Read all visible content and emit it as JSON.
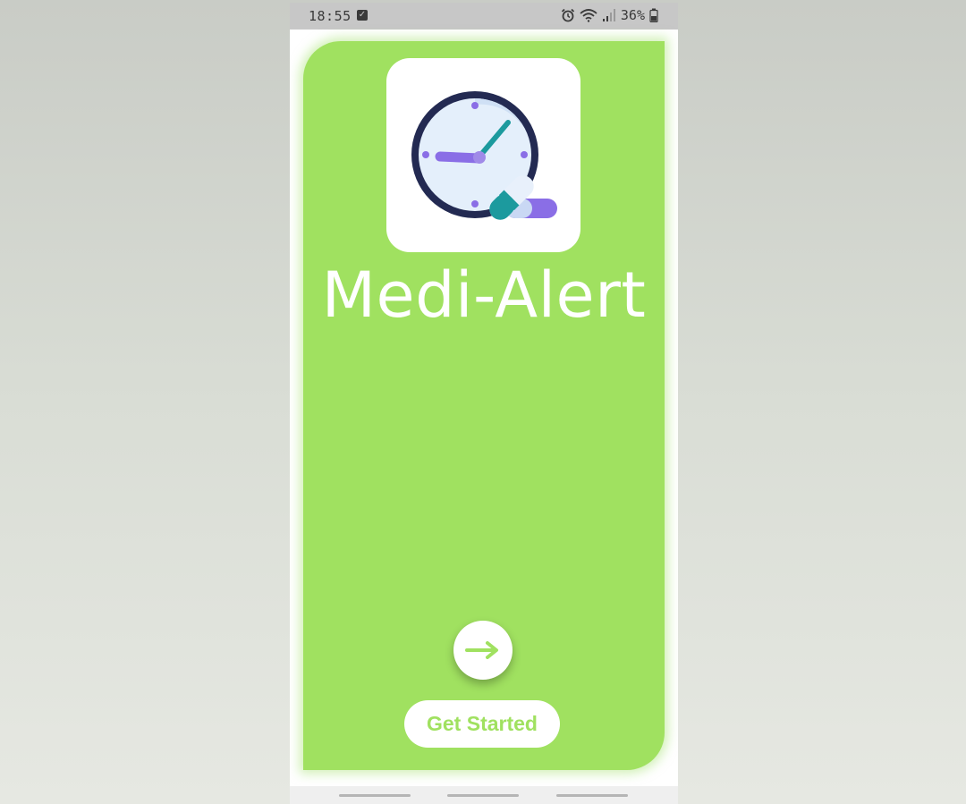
{
  "status_bar": {
    "time": "18:55",
    "battery_percent": "36%",
    "icons": [
      "checkbox-icon",
      "alarm-icon",
      "wifi-icon",
      "signal-icon",
      "battery-icon"
    ]
  },
  "app": {
    "title": "Medi-Alert",
    "logo_icon": "clock-pill-icon",
    "next_icon": "arrow-right-icon",
    "get_started_label": "Get Started"
  },
  "colors": {
    "accent_green": "#a0e160",
    "white": "#ffffff",
    "clock_ring": "#232a52",
    "clock_face": "#e4effb",
    "purple": "#8a6ee6",
    "teal": "#1c9a9e"
  },
  "nav_bar": {
    "icons": [
      "nav-recent-icon",
      "nav-home-icon",
      "nav-back-icon"
    ]
  }
}
